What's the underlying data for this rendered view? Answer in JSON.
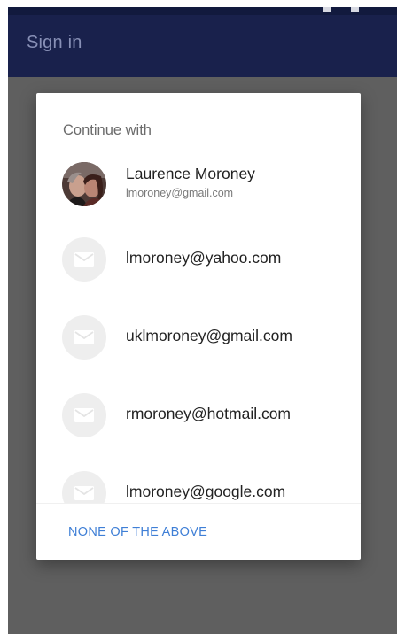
{
  "app_bar": {
    "title": "Sign in"
  },
  "dialog": {
    "title": "Continue with",
    "primary_account": {
      "name": "Laurence Moroney",
      "email": "lmoroney@gmail.com"
    },
    "other_accounts": [
      {
        "email": "lmoroney@yahoo.com"
      },
      {
        "email": "uklmoroney@gmail.com"
      },
      {
        "email": "rmoroney@hotmail.com"
      },
      {
        "email": "lmoroney@google.com"
      }
    ],
    "action_label": "NONE OF THE ABOVE"
  },
  "icons": {
    "account_photo": "user-photo-avatar",
    "email": "mail-envelope-icon"
  },
  "colors": {
    "app_bar": "#19214c",
    "scrim": "#5f5f5f",
    "action": "#3f7fd6",
    "mail_avatar_bg": "#eeeeee"
  }
}
